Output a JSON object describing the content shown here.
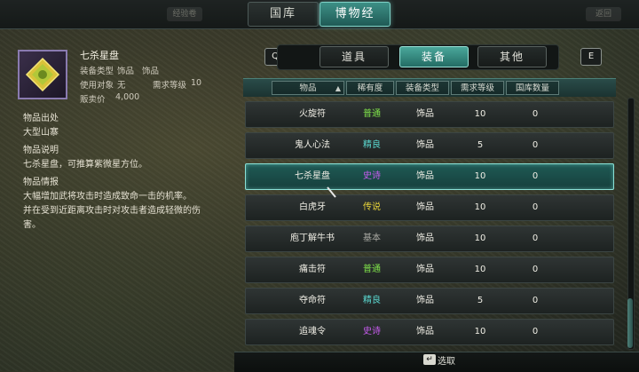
{
  "top_nav": {
    "left_ghost": "经验卷",
    "right_ghost": "返回",
    "tabs": [
      {
        "label": "国库",
        "active": false
      },
      {
        "label": "博物经",
        "active": true
      }
    ]
  },
  "detail": {
    "item_name": "七杀星盘",
    "equip_type_label": "装备类型",
    "equip_type_value": "饰品",
    "equip_type_value2": "饰品",
    "use_target_label": "使用对象",
    "use_target_value": "无",
    "req_level_label": "需求等级",
    "req_level_value": "10",
    "price_label": "贩卖价",
    "price_value": "4,000",
    "origin_heading": "物品出处",
    "origin_text": "大型山寨",
    "desc_heading": "物品说明",
    "desc_text": "七杀星盘，可推算紫微星方位。",
    "info_heading": "物品情报",
    "info_line1": "大幅增加武将攻击时造成致命一击的机率。",
    "info_line2": "并在受到近距离攻击时对攻击者造成轻微的伤",
    "info_line3": "害。"
  },
  "categories": {
    "left_key": "Q",
    "right_key": "E",
    "tabs": [
      {
        "label": "道具",
        "active": false
      },
      {
        "label": "装备",
        "active": true
      },
      {
        "label": "其他",
        "active": false
      }
    ]
  },
  "table": {
    "headers": [
      "物品",
      "稀有度",
      "装备类型",
      "需求等级",
      "国库数量"
    ],
    "rows": [
      {
        "name": "火旋符",
        "rarity": "普通",
        "rarity_color": "#7fe14a",
        "type": "饰品",
        "level": "10",
        "count": "0",
        "selected": false
      },
      {
        "name": "鬼人心法",
        "rarity": "精良",
        "rarity_color": "#5ad8d0",
        "type": "饰品",
        "level": "5",
        "count": "0",
        "selected": false
      },
      {
        "name": "七杀星盘",
        "rarity": "史诗",
        "rarity_color": "#c85cf0",
        "type": "饰品",
        "level": "10",
        "count": "0",
        "selected": true
      },
      {
        "name": "白虎牙",
        "rarity": "传说",
        "rarity_color": "#e6d23a",
        "type": "饰品",
        "level": "10",
        "count": "0",
        "selected": false
      },
      {
        "name": "庖丁解牛书",
        "rarity": "基本",
        "rarity_color": "#a9a9a3",
        "type": "饰品",
        "level": "10",
        "count": "0",
        "selected": false
      },
      {
        "name": "痛击符",
        "rarity": "普通",
        "rarity_color": "#7fe14a",
        "type": "饰品",
        "level": "10",
        "count": "0",
        "selected": false
      },
      {
        "name": "夺命符",
        "rarity": "精良",
        "rarity_color": "#5ad8d0",
        "type": "饰品",
        "level": "5",
        "count": "0",
        "selected": false
      },
      {
        "name": "追魂令",
        "rarity": "史诗",
        "rarity_color": "#c85cf0",
        "type": "饰品",
        "level": "10",
        "count": "0",
        "selected": false
      }
    ]
  },
  "footer": {
    "enter_icon": "enter-key-icon",
    "select_label": "选取"
  }
}
